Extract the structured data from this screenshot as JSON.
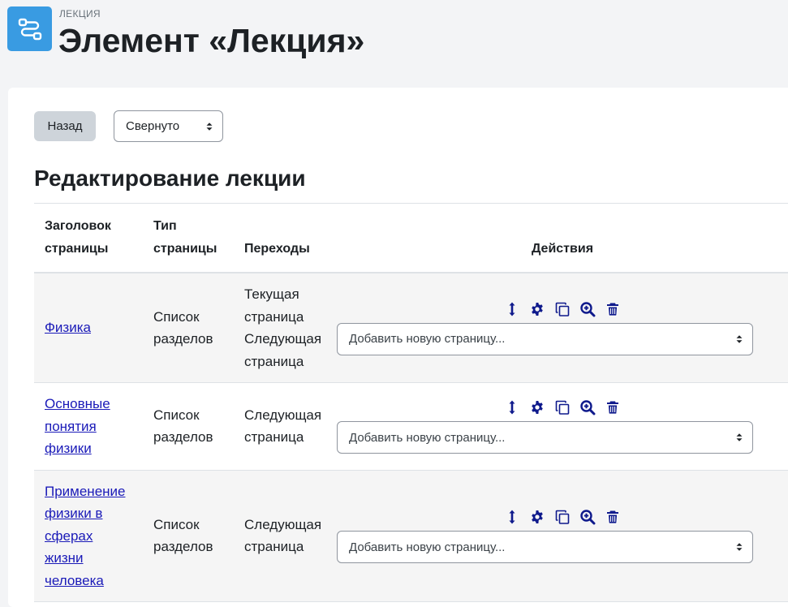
{
  "header": {
    "activity_type": "ЛЕКЦИЯ",
    "title": "Элемент «Лекция»"
  },
  "toolbar": {
    "back_label": "Назад",
    "view_select_value": "Свернуто"
  },
  "section": {
    "title": "Редактирование лекции"
  },
  "table": {
    "headers": {
      "page_title_l1": "Заголовок",
      "page_title_l2": "страницы",
      "type_l1": "Тип",
      "type_l2": "страницы",
      "jumps": "Переходы",
      "actions": "Действия"
    },
    "rows": [
      {
        "title_lines": [
          "Физика"
        ],
        "type_lines": [
          "Список",
          "разделов"
        ],
        "jumps_lines": [
          "Текущая",
          "страница",
          "Следующая",
          "страница"
        ],
        "add_page_value": "Добавить новую страницу..."
      },
      {
        "title_lines": [
          "Основные",
          "понятия",
          "физики"
        ],
        "type_lines": [
          "Список",
          "разделов"
        ],
        "jumps_lines": [
          "Следующая",
          "страница"
        ],
        "add_page_value": "Добавить новую страницу..."
      },
      {
        "title_lines": [
          "Применение",
          "физики в",
          "сферах",
          "жизни",
          "человека"
        ],
        "type_lines": [
          "Список",
          "разделов"
        ],
        "jumps_lines": [
          "Следующая",
          "страница"
        ],
        "add_page_value": "Добавить новую страницу..."
      }
    ]
  },
  "icons": {
    "activity": "lesson-icon",
    "move": "move-icon",
    "edit": "gear-icon",
    "duplicate": "copy-icon",
    "preview": "zoom-in-icon",
    "delete": "trash-icon"
  },
  "colors": {
    "accent": "#399be2",
    "link": "#1a1ab8",
    "icon": "#0f1a8c"
  }
}
